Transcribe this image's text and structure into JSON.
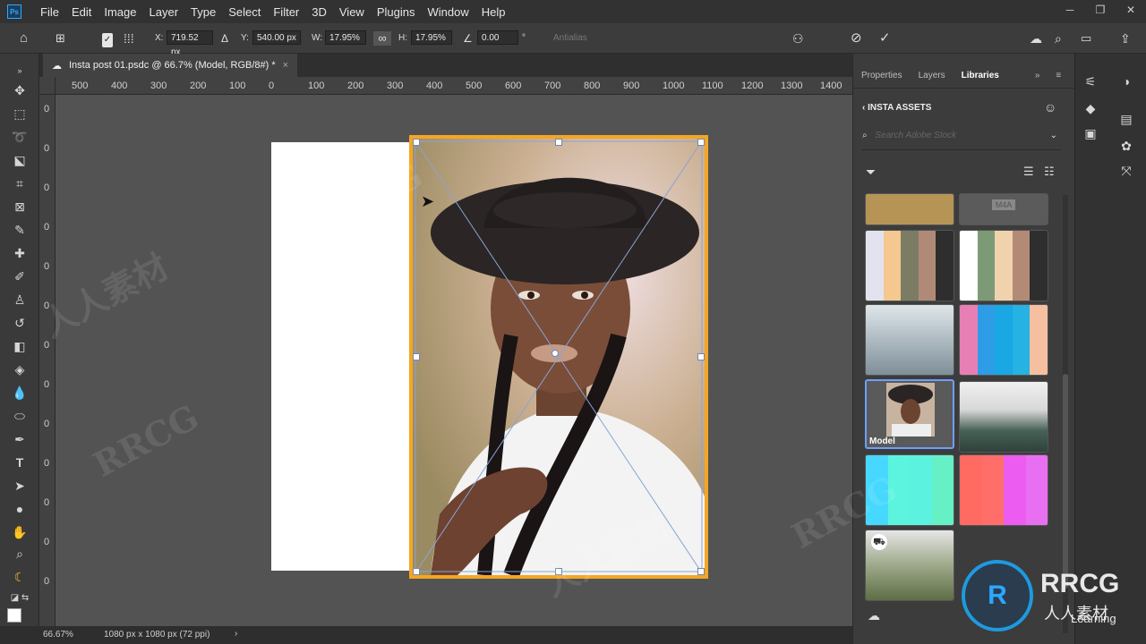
{
  "app": {
    "logo": "Ps"
  },
  "menu": [
    "File",
    "Edit",
    "Image",
    "Layer",
    "Type",
    "Select",
    "Filter",
    "3D",
    "View",
    "Plugins",
    "Window",
    "Help"
  ],
  "options": {
    "x_label": "X:",
    "x_value": "719.52 px",
    "y_label": "Y:",
    "y_value": "540.00 px",
    "w_label": "W:",
    "w_value": "17.95%",
    "h_label": "H:",
    "h_value": "17.95%",
    "angle_value": "0.00",
    "angle_unit": "°",
    "interp_label": "Antialias"
  },
  "document": {
    "tab_title": "Insta post 01.psdc @ 66.7% (Model, RGB/8#) *",
    "close_symbol": "×"
  },
  "ruler": {
    "top": [
      "500",
      "400",
      "300",
      "200",
      "100",
      "0",
      "100",
      "200",
      "300",
      "400",
      "500",
      "600",
      "700",
      "800",
      "900",
      "1000",
      "1100",
      "1200",
      "1300",
      "1400"
    ],
    "left": [
      "0",
      "0",
      "0",
      "0",
      "0",
      "0",
      "0",
      "0",
      "0",
      "0",
      "0",
      "0",
      "0"
    ]
  },
  "status": {
    "zoom": "66.67%",
    "doc_info": "1080 px x 1080 px (72 ppi)"
  },
  "panel": {
    "tabs": [
      "Properties",
      "Layers",
      "Libraries"
    ],
    "active_tab": "Libraries",
    "library_name": "INSTA ASSETS",
    "search_placeholder": "Search Adobe Stock",
    "m4a_label": "M4A",
    "model_label": "Model"
  },
  "palettes": {
    "p1": [
      "#e3e3ef",
      "#f4c88f",
      "#7c7c65",
      "#b08a76",
      "#2e2e2e"
    ],
    "p2": [
      "#ffffff",
      "#7c9a76",
      "#f0d2ad",
      "#b38a76",
      "#2e2e2e"
    ],
    "p4": [
      "#e77fb5",
      "#2d9de8",
      "#19a8e3",
      "#26b2e2",
      "#f6c0a0"
    ],
    "p5": [
      "#47d8ff",
      "#5cf4df",
      "#5cf2e0",
      "#66f0c6"
    ],
    "p6": [
      "#ff6b61",
      "#ff6e69",
      "#ec5cf0",
      "#e96ff2"
    ]
  },
  "watermark": {
    "text": "RRCG",
    "cn": "人人素材",
    "brand": "Learning"
  }
}
